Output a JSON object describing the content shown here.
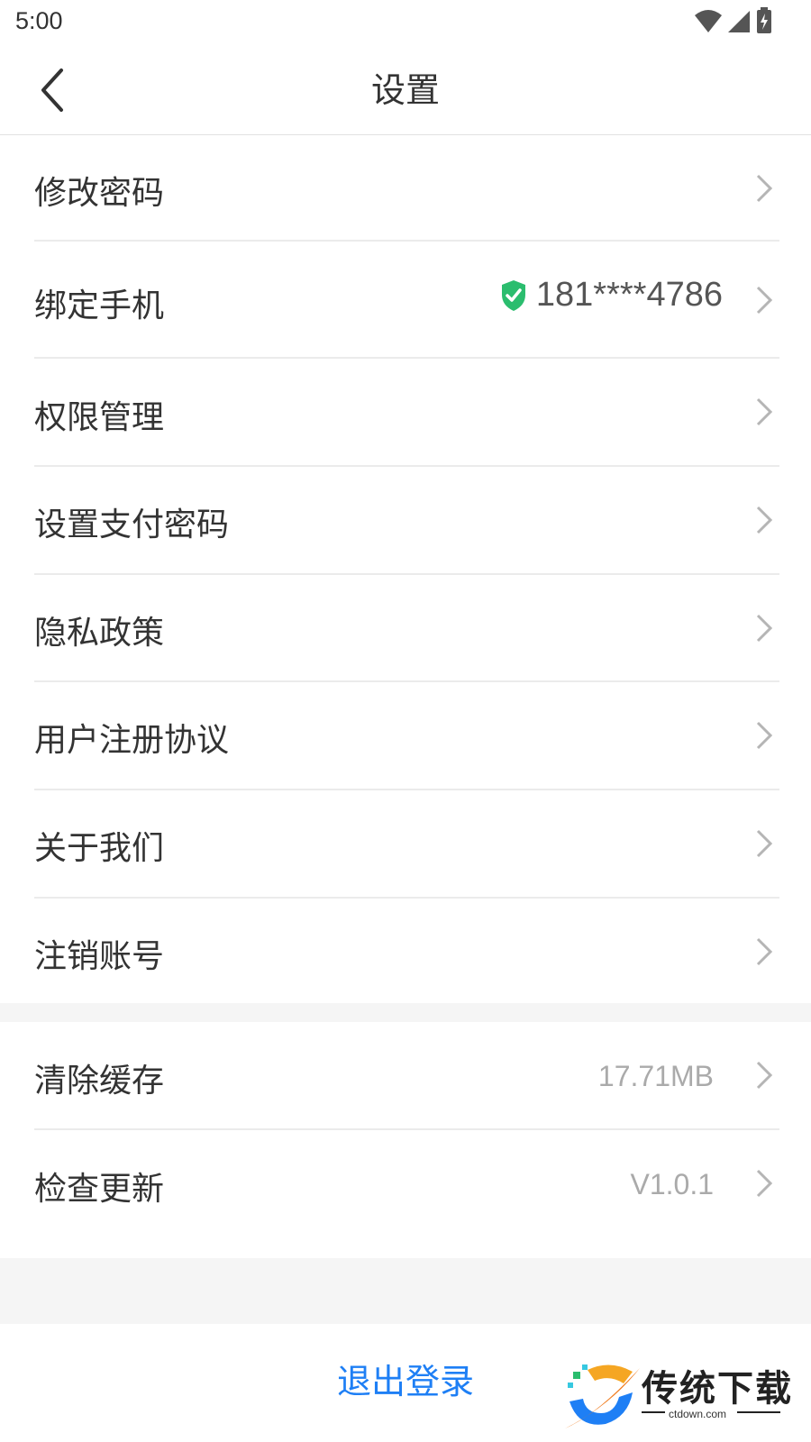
{
  "status_bar": {
    "time": "5:00"
  },
  "header": {
    "title": "设置"
  },
  "menu_group_1": [
    {
      "label": "修改密码"
    },
    {
      "label": "绑定手机",
      "value": "181****4786"
    },
    {
      "label": "权限管理"
    },
    {
      "label": "设置支付密码"
    },
    {
      "label": "隐私政策"
    },
    {
      "label": "用户注册协议"
    },
    {
      "label": "关于我们"
    },
    {
      "label": "注销账号"
    }
  ],
  "menu_group_2": [
    {
      "label": "清除缓存",
      "value": "17.71MB"
    },
    {
      "label": "检查更新",
      "value": "V1.0.1"
    }
  ],
  "logout": {
    "label": "退出登录"
  },
  "watermark": {
    "title": "传统下载",
    "subtitle": "ctdown.com"
  },
  "colors": {
    "accent": "#1e7ff5",
    "verified": "#2bbd6e"
  }
}
